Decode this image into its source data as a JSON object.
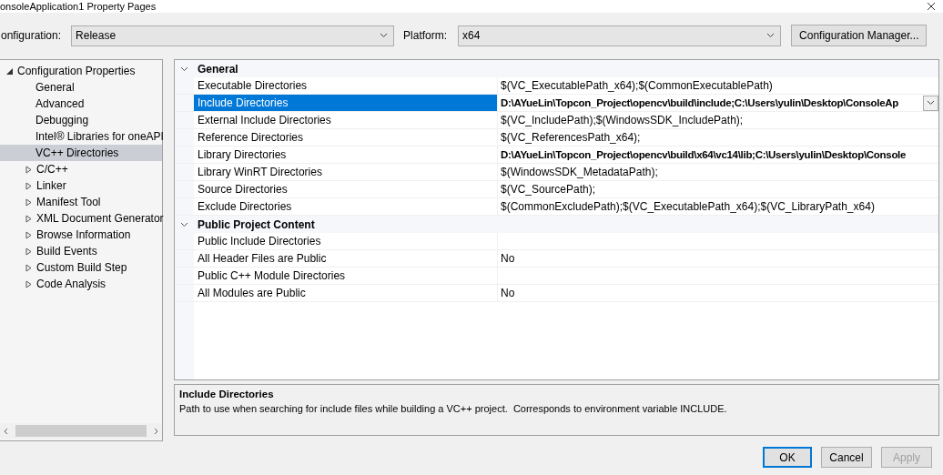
{
  "window": {
    "title": "onsoleApplication1 Property Pages"
  },
  "configuration": {
    "label": "onfiguration:",
    "value": "Release"
  },
  "platform": {
    "label": "Platform:",
    "value": "x64"
  },
  "config_manager_button": "Configuration Manager...",
  "tree": [
    {
      "label": "Configuration Properties",
      "expanded": true,
      "selected": false,
      "children": [
        {
          "label": "General",
          "selected": false
        },
        {
          "label": "Advanced",
          "selected": false
        },
        {
          "label": "Debugging",
          "selected": false
        },
        {
          "label": "Intel® Libraries for oneAPI",
          "selected": false
        },
        {
          "label": "VC++ Directories",
          "selected": true
        },
        {
          "label": "C/C++",
          "expanded": false,
          "selected": false
        },
        {
          "label": "Linker",
          "expanded": false,
          "selected": false
        },
        {
          "label": "Manifest Tool",
          "expanded": false,
          "selected": false
        },
        {
          "label": "XML Document Generator",
          "expanded": false,
          "selected": false
        },
        {
          "label": "Browse Information",
          "expanded": false,
          "selected": false
        },
        {
          "label": "Build Events",
          "expanded": false,
          "selected": false
        },
        {
          "label": "Custom Build Step",
          "expanded": false,
          "selected": false
        },
        {
          "label": "Code Analysis",
          "expanded": false,
          "selected": false
        }
      ]
    }
  ],
  "grid": [
    {
      "category": "General",
      "expanded": true,
      "rows": [
        {
          "name": "Executable Directories",
          "value": "$(VC_ExecutablePath_x64);$(CommonExecutablePath)",
          "bold": false,
          "selected": false
        },
        {
          "name": "Include Directories",
          "value": "D:\\AYueLin\\Topcon_Project\\opencv\\build\\include;C:\\Users\\yulin\\Desktop\\ConsoleAp",
          "bold": true,
          "selected": true
        },
        {
          "name": "External Include Directories",
          "value": "$(VC_IncludePath);$(WindowsSDK_IncludePath);",
          "bold": false,
          "selected": false
        },
        {
          "name": "Reference Directories",
          "value": "$(VC_ReferencesPath_x64);",
          "bold": false,
          "selected": false
        },
        {
          "name": "Library Directories",
          "value": "D:\\AYueLin\\Topcon_Project\\opencv\\build\\x64\\vc14\\lib;C:\\Users\\yulin\\Desktop\\Console",
          "bold": true,
          "selected": false
        },
        {
          "name": "Library WinRT Directories",
          "value": "$(WindowsSDK_MetadataPath);",
          "bold": false,
          "selected": false
        },
        {
          "name": "Source Directories",
          "value": "$(VC_SourcePath);",
          "bold": false,
          "selected": false
        },
        {
          "name": "Exclude Directories",
          "value": "$(CommonExcludePath);$(VC_ExecutablePath_x64);$(VC_LibraryPath_x64)",
          "bold": false,
          "selected": false
        }
      ]
    },
    {
      "category": "Public Project Content",
      "expanded": true,
      "rows": [
        {
          "name": "Public Include Directories",
          "bold": false,
          "selected": false
        },
        {
          "name": "All Header Files are Public",
          "value": "No",
          "bold": false,
          "selected": false
        },
        {
          "name": "Public C++ Module Directories",
          "bold": false,
          "selected": false
        },
        {
          "name": "All Modules are Public",
          "value": "No",
          "bold": false,
          "selected": false
        }
      ]
    }
  ],
  "description": {
    "title": "Include Directories",
    "text": "Path to use when searching for include files while building a VC++ project.  Corresponds to environment variable INCLUDE."
  },
  "buttons": [
    {
      "label": "OK",
      "kind": "default",
      "disabled": false
    },
    {
      "label": "Cancel",
      "kind": "normal",
      "disabled": false
    },
    {
      "label": "Apply",
      "kind": "normal",
      "disabled": true
    }
  ]
}
